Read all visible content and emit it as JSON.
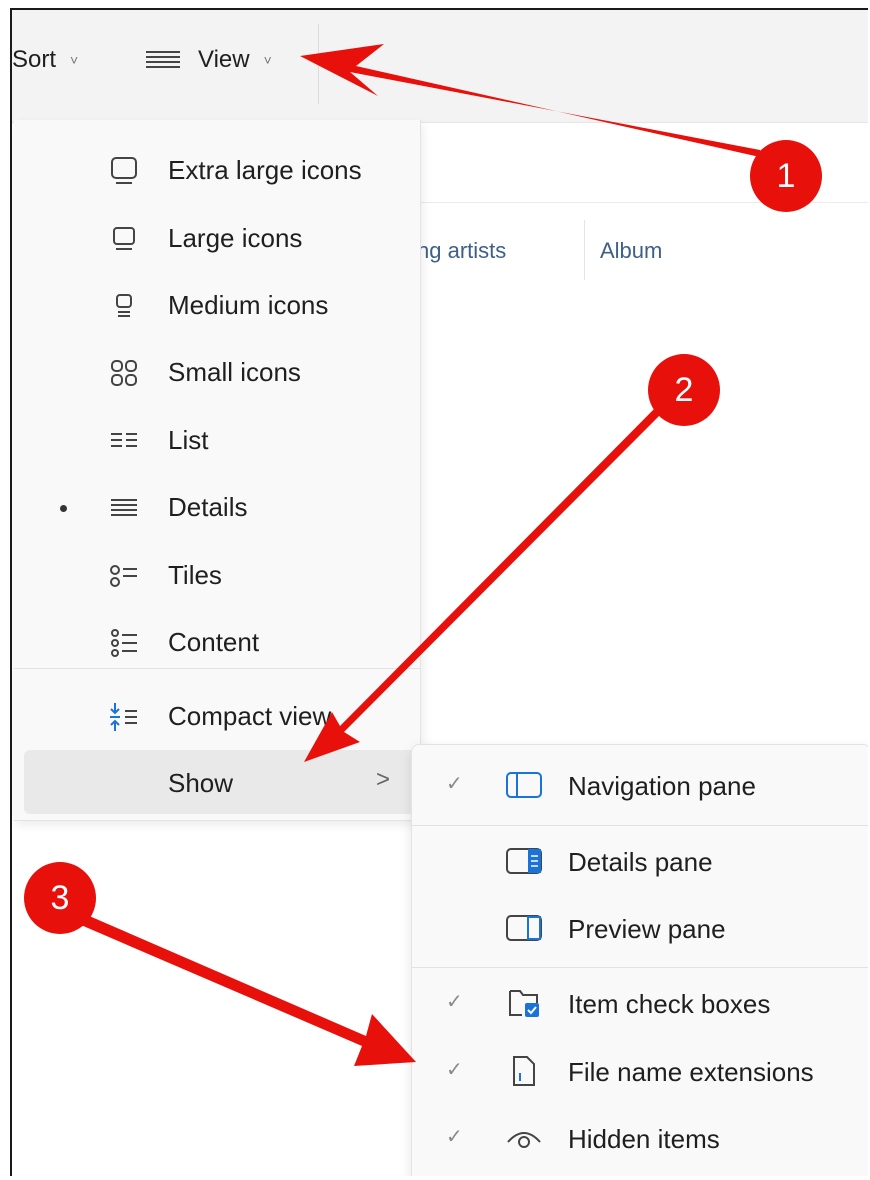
{
  "toolbar": {
    "sort_label": "Sort",
    "view_label": "View",
    "chevron": "˅"
  },
  "columns": {
    "artists_partial": "ng artists",
    "album": "Album"
  },
  "view_menu": {
    "items": [
      {
        "label": "Extra large icons",
        "icon": "extra-large-icons-icon"
      },
      {
        "label": "Large icons",
        "icon": "large-icons-icon"
      },
      {
        "label": "Medium icons",
        "icon": "medium-icons-icon"
      },
      {
        "label": "Small icons",
        "icon": "small-icons-icon"
      },
      {
        "label": "List",
        "icon": "list-icon"
      },
      {
        "label": "Details",
        "icon": "details-icon",
        "selected": true
      },
      {
        "label": "Tiles",
        "icon": "tiles-icon"
      },
      {
        "label": "Content",
        "icon": "content-icon"
      }
    ],
    "compact_label": "Compact view",
    "show_label": "Show",
    "show_chevron": ">"
  },
  "show_submenu": {
    "items": [
      {
        "label": "Navigation pane",
        "checked": true,
        "icon": "navigation-pane-icon"
      },
      {
        "label": "Details pane",
        "checked": false,
        "icon": "details-pane-icon"
      },
      {
        "label": "Preview pane",
        "checked": false,
        "icon": "preview-pane-icon"
      },
      {
        "label": "Item check boxes",
        "checked": true,
        "icon": "item-check-boxes-icon"
      },
      {
        "label": "File name extensions",
        "checked": true,
        "icon": "file-name-extensions-icon"
      },
      {
        "label": "Hidden items",
        "checked": true,
        "icon": "hidden-items-icon"
      }
    ],
    "check_glyph": "✓"
  },
  "callouts": {
    "one": "1",
    "two": "2",
    "three": "3"
  },
  "colors": {
    "callout_red": "#e8100b",
    "accent_blue": "#1a73d9"
  }
}
